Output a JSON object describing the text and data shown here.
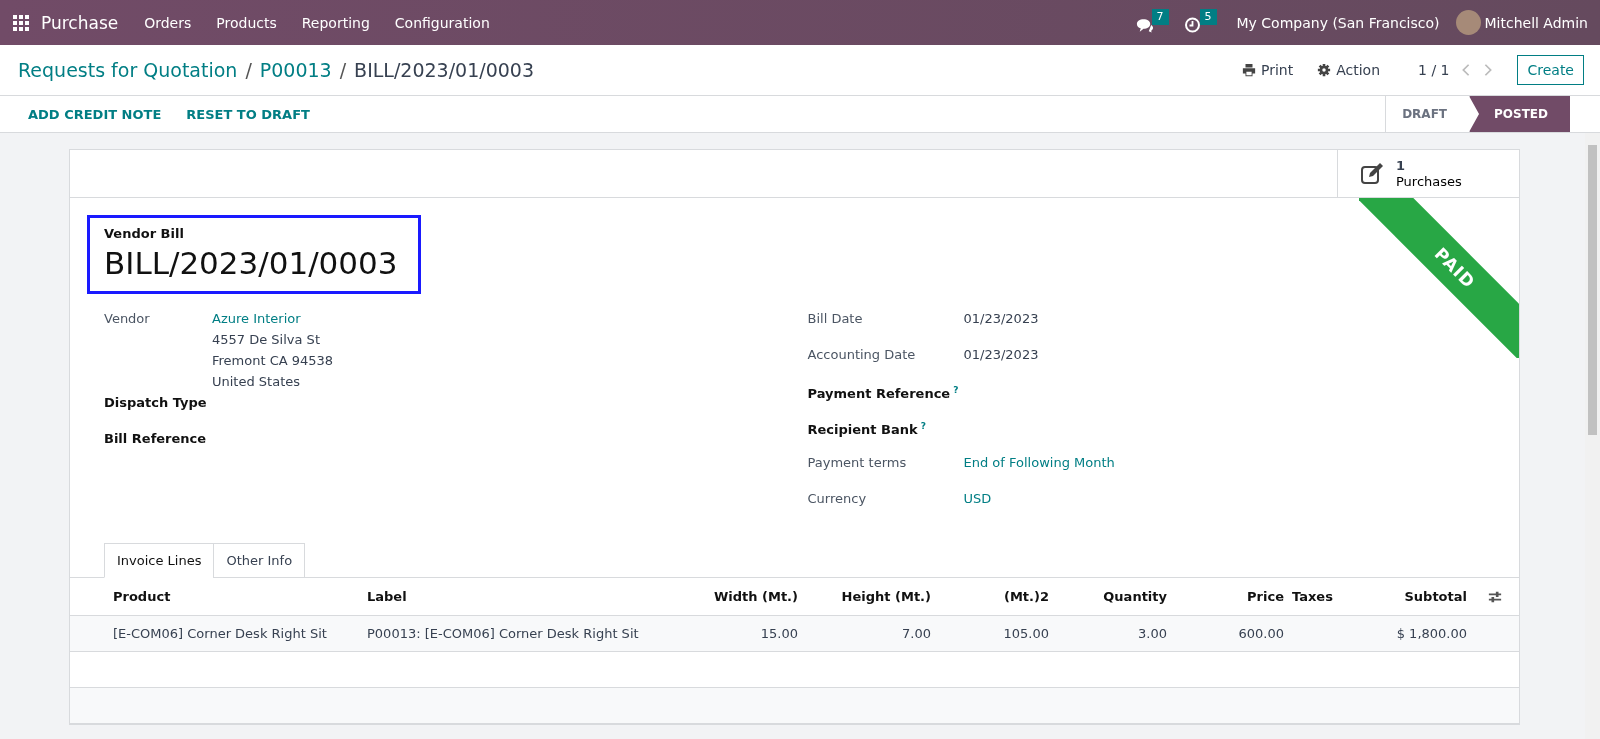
{
  "navbar": {
    "app": "Purchase",
    "menu": [
      "Orders",
      "Products",
      "Reporting",
      "Configuration"
    ],
    "messages_count": "7",
    "activities_count": "5",
    "company": "My Company (San Francisco)",
    "user": "Mitchell Admin"
  },
  "breadcrumb_separator": "/",
  "breadcrumbs": [
    {
      "label": "Requests for Quotation",
      "link": true
    },
    {
      "label": "P00013",
      "link": true
    },
    {
      "label": "BILL/2023/01/0003",
      "link": false
    }
  ],
  "toolbar": {
    "print": "Print",
    "action": "Action",
    "pager": "1 / 1",
    "create": "Create"
  },
  "actions": [
    "ADD CREDIT NOTE",
    "RESET TO DRAFT"
  ],
  "statusbar": [
    {
      "label": "DRAFT",
      "selected": false
    },
    {
      "label": "POSTED",
      "selected": true
    }
  ],
  "smart_button": {
    "count": "1",
    "label": "Purchases"
  },
  "ribbon": "PAID",
  "title": {
    "caption": "Vendor Bill",
    "name": "BILL/2023/01/0003"
  },
  "left_fields": [
    {
      "label": "Vendor",
      "bold": false,
      "value": "Azure Interior",
      "link": true,
      "address": [
        "4557 De Silva St",
        "Fremont CA 94538",
        "United States"
      ]
    },
    {
      "label": "Dispatch Type",
      "bold": true
    },
    {
      "label": "Bill Reference",
      "bold": true
    }
  ],
  "right_fields": [
    {
      "label": "Bill Date",
      "bold": false,
      "value": "01/23/2023",
      "link": false
    },
    {
      "label": "Accounting Date",
      "bold": false,
      "value": "01/23/2023",
      "link": false
    },
    {
      "label": "Payment Reference",
      "bold": true,
      "help": "?"
    },
    {
      "label": "Recipient Bank",
      "bold": true,
      "help": "?"
    },
    {
      "label": "Payment terms",
      "bold": false,
      "value": "End of Following Month",
      "link": true
    },
    {
      "label": "Currency",
      "bold": false,
      "value": "USD",
      "link": true
    }
  ],
  "tabs": [
    {
      "label": "Invoice Lines",
      "selected": true
    },
    {
      "label": "Other Info",
      "selected": false
    }
  ],
  "table": {
    "columns": [
      {
        "label": "Product",
        "kind": "text"
      },
      {
        "label": "Label",
        "kind": "text"
      },
      {
        "label": "Width (Mt.)",
        "kind": "number"
      },
      {
        "label": "Height (Mt.)",
        "kind": "number"
      },
      {
        "label": "(Mt.)2",
        "kind": "number"
      },
      {
        "label": "Quantity",
        "kind": "number"
      },
      {
        "label": "Price",
        "kind": "number"
      },
      {
        "label": "Taxes",
        "kind": "text"
      },
      {
        "label": "Subtotal",
        "kind": "number"
      }
    ],
    "rows": [
      [
        "[E-COM06] Corner Desk Right Sit",
        "P00013: [E-COM06] Corner Desk Right Sit",
        "15.00",
        "7.00",
        "105.00",
        "3.00",
        "600.00",
        "",
        "$ 1,800.00"
      ]
    ]
  }
}
